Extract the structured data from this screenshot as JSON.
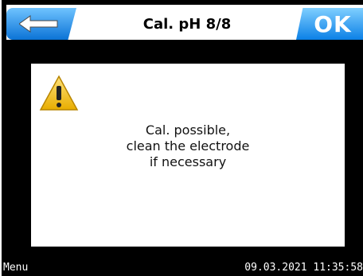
{
  "header": {
    "title": "Cal. pH 8/8",
    "back_icon": "arrow-left-icon",
    "ok_label": "OK"
  },
  "dialog": {
    "icon": "warning-triangle-icon",
    "message_lines": [
      "Cal. possible,",
      "clean the electrode",
      "if necessary"
    ]
  },
  "footer": {
    "menu_label": "Menu",
    "datetime": "09.03.2021 11:35:58"
  },
  "colors": {
    "background": "#000000",
    "accent_blue": "#0b73d6",
    "warning_yellow": "#f3c300"
  }
}
